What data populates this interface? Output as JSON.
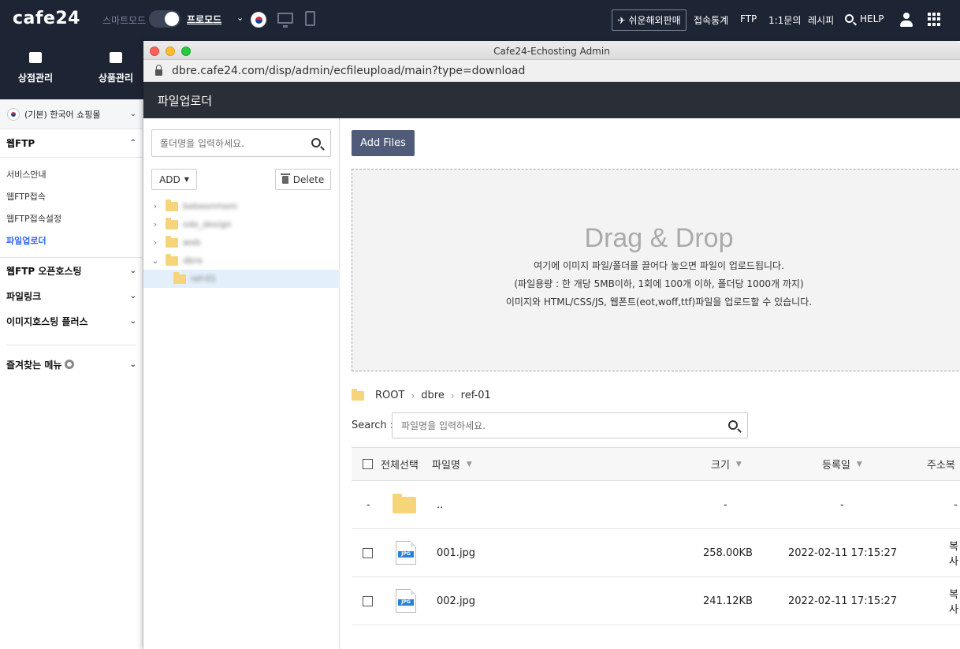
{
  "topbar": {
    "logo": "cafe24",
    "mode_label": "스마트모드",
    "pro_mode": "프로모드",
    "overseas_button": "쉬운해외판매",
    "links": [
      "접속통계",
      "FTP",
      "1:1문의",
      "레시피"
    ],
    "help": "HELP"
  },
  "left_nav": {
    "items": [
      "상점관리",
      "상품관리"
    ]
  },
  "sidebar": {
    "shop": "(기본) 한국어 쇼핑몰",
    "section": "웹FTP",
    "sub_items": [
      "서비스안내",
      "웹FTP접속",
      "웹FTP접속설정",
      "파일업로더"
    ],
    "active_item": "파일업로더",
    "categories": [
      "웹FTP 오픈호스팅",
      "파일링크",
      "이미지호스팅 플러스"
    ],
    "favorites": "즐겨찾는 메뉴"
  },
  "window": {
    "title": "Cafe24-Echosting Admin",
    "url": "dbre.cafe24.com/disp/admin/ecfileupload/main?type=download",
    "header": "파일업로더"
  },
  "tree": {
    "search_placeholder": "폴더명을 입력하세요.",
    "add_label": "ADD",
    "delete_label": "Delete",
    "folders": [
      {
        "name": "bebeonmom",
        "expanded": false
      },
      {
        "name": "sde_design",
        "expanded": false
      },
      {
        "name": "web",
        "expanded": false
      },
      {
        "name": "dbre",
        "expanded": true
      }
    ],
    "selected_child": "ref-01"
  },
  "main": {
    "add_files": "Add Files",
    "dropzone": {
      "title": "Drag & Drop",
      "line1": "여기에 이미지 파일/폴더를 끌어다 놓으면 파일이 업로드됩니다.",
      "line2": "(파일용량 : 한 개당 5MB이하, 1회에 100개 이하, 폴더당 1000개 까지)",
      "line3": "이미지와 HTML/CSS/JS, 웹폰트(eot,woff,ttf)파일을 업로드할 수 있습니다."
    },
    "breadcrumb": [
      "ROOT",
      "dbre",
      "ref-01"
    ],
    "search_label": "Search :",
    "search_placeholder": "파일명을 입력하세요.",
    "columns": {
      "select_all": "전체선택",
      "filename": "파일명",
      "size": "크기",
      "date": "등록일",
      "address": "주소복"
    },
    "parent_row": {
      "name": "..",
      "dash": "-"
    },
    "files": [
      {
        "name": "001.jpg",
        "size": "258.00KB",
        "date": "2022-02-11 17:15:27",
        "action": "복사"
      },
      {
        "name": "002.jpg",
        "size": "241.12KB",
        "date": "2022-02-11 17:15:27",
        "action": "복사"
      }
    ],
    "icon_label": "JPG"
  }
}
